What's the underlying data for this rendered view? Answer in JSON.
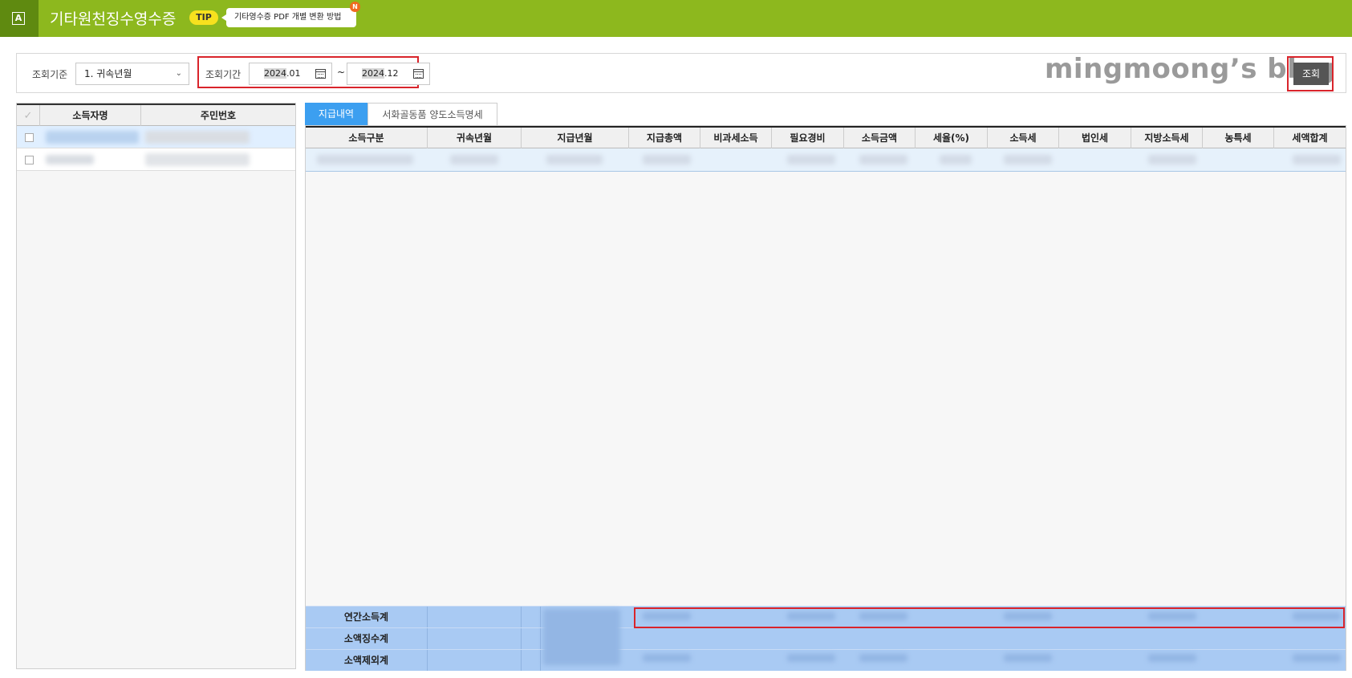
{
  "header": {
    "app_icon_letter": "A",
    "title": "기타원천징수영수증",
    "tip_badge": "TIP",
    "tip_text": "기타영수증 PDF 개별 변환 방법",
    "new_badge": "N"
  },
  "filter": {
    "basis_label": "조회기준",
    "basis_value": "1. 귀속년월",
    "period_label": "조회기간",
    "from_year": "2024",
    "from_month": ".01",
    "to_year": "2024",
    "to_month": ".12",
    "separator": "~",
    "search_label": "조회"
  },
  "watermark": "mingmoong’s blog",
  "left_grid": {
    "check_header": "✓",
    "columns": [
      "소득자명",
      "주민번호"
    ]
  },
  "tabs": [
    "지급내역",
    "서화골동품 양도소득명세"
  ],
  "main_grid": {
    "columns": [
      "소득구분",
      "귀속년월",
      "지급년월",
      "지급총액",
      "비과세소득",
      "필요경비",
      "소득금액",
      "세율(%)",
      "소득세",
      "법인세",
      "지방소득세",
      "농특세",
      "세액합계"
    ]
  },
  "summary_rows": [
    "연간소득계",
    "소액징수계",
    "소액제외계"
  ],
  "colors": {
    "topbar": "#8db81e",
    "accent_tab": "#3c9ff0",
    "highlight": "#d9242b",
    "summary": "#a9caf3"
  }
}
